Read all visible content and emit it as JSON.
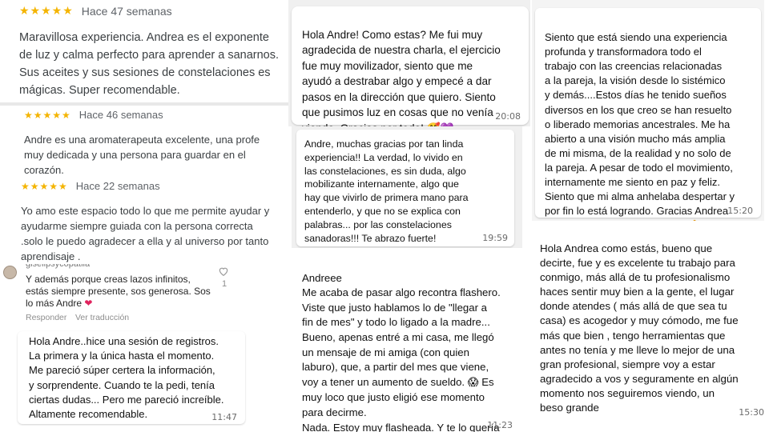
{
  "reviews": [
    {
      "stars": "★★★★★",
      "ago": "Hace 47 semanas",
      "text": "Maravillosa experiencia. Andrea es el exponente de luz y calma perfecto para aprender a sanarnos. Sus aceites y sus sesiones de constelaciones es mágicas. Super recomendable."
    },
    {
      "stars": "★★★★★",
      "ago": "Hace 46 semanas",
      "text": "Andre es una aromaterapeuta excelente, una profe muy dedicada y una persona para guardar en el corazón."
    },
    {
      "stars": "★★★★★",
      "ago": "Hace 22 semanas",
      "text": "Yo amo este espacio todo lo que me permite ayudar y ayudarme siempre guiada con la persona correcta .solo le puedo agradecer a ella y al universo por tanto aprendisaje ."
    }
  ],
  "comment": {
    "username": "gisellpsycopatila",
    "text": "Y además porque creas lazos infinitos, estás siempre presente,  sos generosa. Sos lo más Andre",
    "heart_emoji": "❤",
    "like_count": "1",
    "reply_label": "Responder",
    "translate_label": "Ver traducción"
  },
  "chats": {
    "registros": {
      "text": "Hola Andre..hice una sesión de registros.\nLa primera y la única hasta el momento.\nMe pareció súper certera la información,\ny sorprendente. Cuando te la pedi, tenía\nciertas dudas... Pero me pareció increíble.\nAltamente recomendable.",
      "time": "11:47"
    },
    "charla": {
      "text": "Hola Andre! Como estas? Me fui muy\nagradecida de nuestra charla, el ejercicio\nfue muy movilizador, siento que me\nayudó a destrabar algo y empecé a dar\npasos en la dirección que quiero.  Siento\nque pusimos luz  en cosas que no venía\nviendo. Gracias por todo!",
      "emojis": "🥰💜",
      "time": "20:08"
    },
    "constelaciones": {
      "text": "Andre, muchas gracias por tan linda\nexperiencia!!  La verdad, lo vivido en\nlas constelaciones, es sin duda, algo\nmobilizante internamente, algo que\nhay que vivirlo de primera mano para\nentenderlo, y que no se explica con\npalabras... por las constelaciones\nsanadoras!!! Te abrazo fuerte!",
      "time": "19:59"
    },
    "flasheada": {
      "text1": "Andreee\nMe acaba de pasar algo recontra flashero.\nViste que justo hablamos lo de \"llegar a\nfin de mes\" y todo lo ligado a la madre...\nBueno, apenas entré a mi casa, me llegó\nun mensaje de mi amiga (con quien\nlaburo), que, a partir del mes que viene,\nvoy a tener un aumento de sueldo.",
      "emoji1": "😱",
      "text2": "Es\nmuy loco que justo eligió ese momento\npara decirme.\nNada. Estoy muy flasheada. Y te lo quería\ncontar.",
      "emoji2": "😍",
      "time": "11:23"
    },
    "transformadora": {
      "text": "Siento que está siendo una experiencia\nprofunda y transformadora todo el\ntrabajo con las creencias relacionadas\na la pareja, la visión desde lo sistémico\ny demás....Estos días he tenido sueños\ndiversos en los que creo se han resuelto\no liberado memorias ancestrales. Me ha\nabierto a una visión mucho más amplia\nde mi misma,  de la realidad y no solo de\nla pareja. A pesar de todo el movimiento,\ninternamente me siento en paz y feliz.\nSiento que mi alma anhelaba despertar y\npor fin lo está logrando. Gracias Andrea\npor tu disposición a esta labor.",
      "emoji": "🙏",
      "time": "15:20"
    },
    "profesional": {
      "text": "Hola Andrea como estás, bueno que\ndecirte, fue y es excelente tu trabajo para\nconmigo, más allá de tu profesionalismo\nhaces sentir muy bien a la gente, el lugar\ndonde atendes ( más allá de que sea tu\ncasa) es acogedor y muy cómodo, me fue\nmás que bien , tengo herramientas que\nantes no tenía y me lleve lo mejor de una\ngran profesional, siempre voy a estar\nagradecido a vos y seguramente en algún\nmomento nos seguiremos viendo, un\nbeso grande",
      "time": "15:30"
    }
  }
}
